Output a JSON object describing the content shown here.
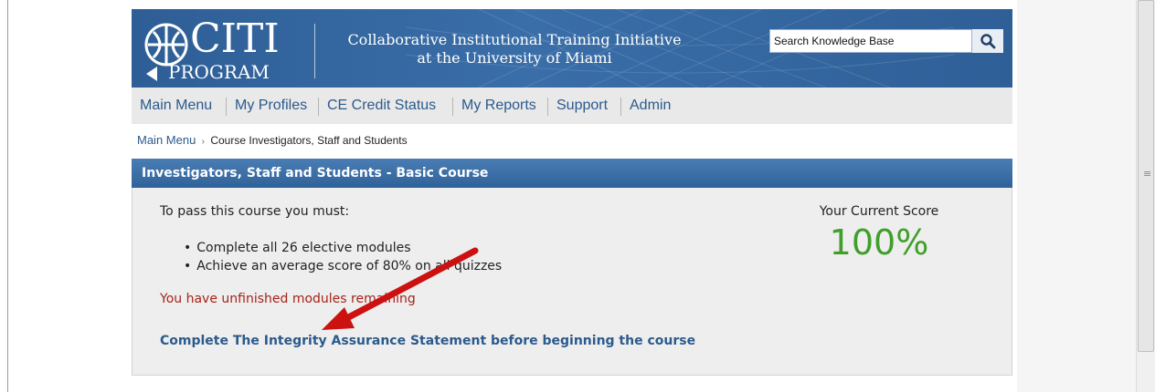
{
  "header": {
    "logo_top": "CITI",
    "logo_bottom": "PROGRAM",
    "tagline_line1": "Collaborative Institutional Training Initiative",
    "tagline_line2": "at the University of Miami",
    "search_placeholder": "Search Knowledge Base"
  },
  "nav": {
    "items": [
      "Main Menu",
      "My Profiles",
      "CE Credit Status",
      "My Reports",
      "Support",
      "Admin"
    ]
  },
  "breadcrumb": {
    "root": "Main Menu",
    "separator": "›",
    "current": "Course Investigators, Staff and Students"
  },
  "course": {
    "title": "Investigators, Staff and Students - Basic Course",
    "requirements_title": "To pass this course you must:",
    "requirements": [
      "Complete all 26 elective modules",
      "Achieve an average score of 80% on all quizzes"
    ],
    "warning": "You have unfinished modules remaining",
    "action_link": "Complete The Integrity Assurance Statement before beginning the course",
    "score_label": "Your Current Score",
    "score_value": "100%"
  },
  "annotation": {
    "arrow_color": "#cc1111"
  },
  "colors": {
    "header_blue": "#3a6ea8",
    "nav_link": "#2b5a8c",
    "score_green": "#3f9f2a",
    "warning_red": "#a5231b"
  }
}
